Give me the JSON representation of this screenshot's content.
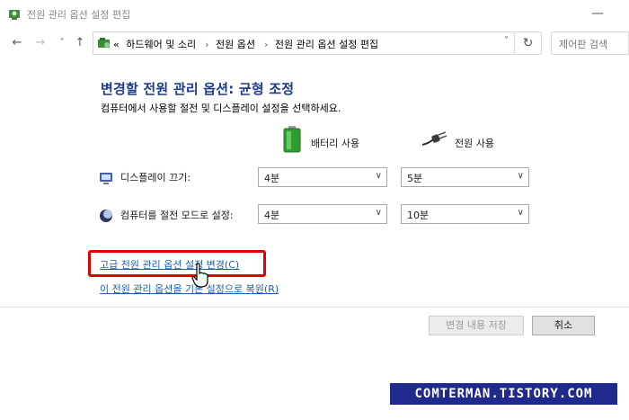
{
  "window": {
    "title": "전원 관리 옵션 설정 편집"
  },
  "nav": {
    "back": "←",
    "forward": "→",
    "history": "˅",
    "up": "↑",
    "breadcrumbs": [
      "«",
      "하드웨어 및 소리",
      "전원 옵션",
      "전원 관리 옵션 설정 편집"
    ],
    "separator": "›",
    "dropdown": "˅",
    "refresh": "↻",
    "search_placeholder": "제어판 검색"
  },
  "page": {
    "heading": "변경할 전원 관리 옵션: 균형 조정",
    "subtext": "컴퓨터에서 사용할 절전 및 디스플레이 설정을 선택하세요.",
    "columns": {
      "battery": "배터리 사용",
      "plugged": "전원 사용"
    },
    "settings": [
      {
        "label": "디스플레이 끄기:",
        "battery": "4분",
        "plugged": "5분"
      },
      {
        "label": "컴퓨터를 절전 모드로 설정:",
        "battery": "4분",
        "plugged": "10분"
      }
    ],
    "links": {
      "advanced": "고급 전원 관리 옵션 설정 변경(C)",
      "restore": "이 전원 관리 옵션을 기본 설정으로 복원(R)"
    }
  },
  "footer": {
    "save": "변경 내용 저장",
    "cancel": "취소"
  },
  "watermark": "COMTERMAN.TISTORY.COM",
  "colors": {
    "heading": "#1e3a8a",
    "link": "#1a5fb4",
    "highlight": "#e10000",
    "watermark_bg": "#1f2a8c"
  }
}
